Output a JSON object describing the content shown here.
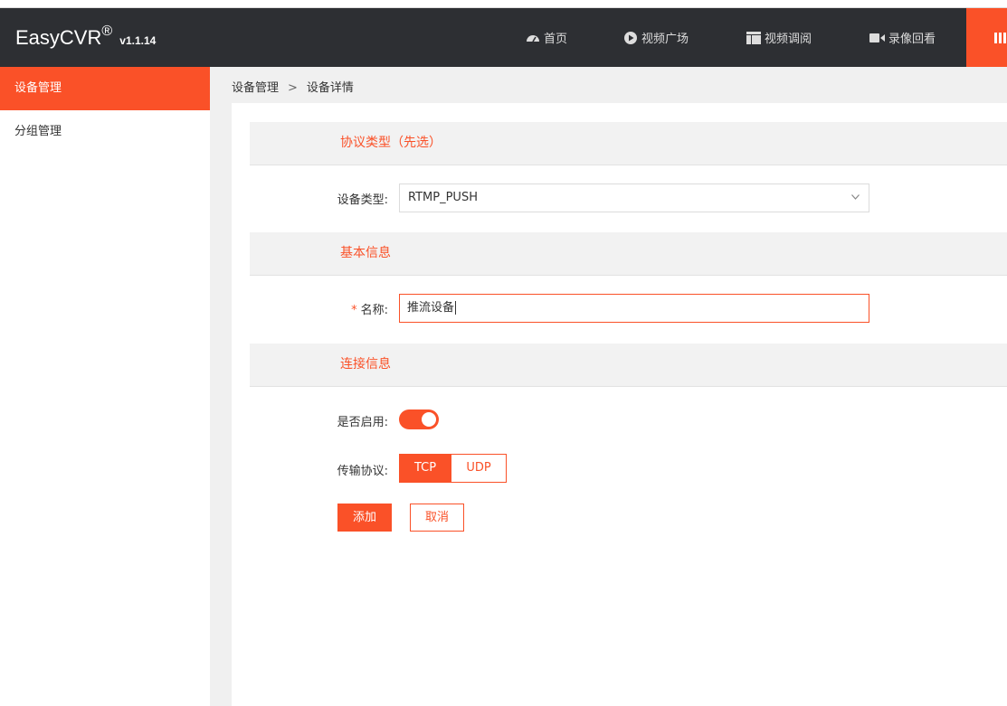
{
  "app": {
    "logo": "EasyCVR",
    "logo_reg": "®",
    "version": "v1.1.14"
  },
  "nav": {
    "items": [
      {
        "label": "首页",
        "icon": "dashboard-icon"
      },
      {
        "label": "视频广场",
        "icon": "play-circle-icon"
      },
      {
        "label": "视频调阅",
        "icon": "layout-icon"
      },
      {
        "label": "录像回看",
        "icon": "video-camera-icon"
      }
    ],
    "accent_icon": "columns-icon"
  },
  "sidebar": {
    "items": [
      {
        "label": "设备管理",
        "active": true
      },
      {
        "label": "分组管理",
        "active": false
      }
    ]
  },
  "breadcrumb": {
    "root": "设备管理",
    "separator": ">",
    "current": "设备详情"
  },
  "form": {
    "protocol_section": "协议类型（先选）",
    "device_type_label": "设备类型:",
    "device_type_value": "RTMP_PUSH",
    "basic_section": "基本信息",
    "name_required_mark": "*",
    "name_label": "名称:",
    "name_value": "推流设备",
    "connection_section": "连接信息",
    "enable_label": "是否启用:",
    "enabled": true,
    "transport_label": "传输协议:",
    "transport_options": [
      "TCP",
      "UDP"
    ],
    "transport_selected": "TCP",
    "add_button": "添加",
    "cancel_button": "取消"
  },
  "colors": {
    "accent": "#fa5128",
    "topbar": "#2d2f33"
  }
}
